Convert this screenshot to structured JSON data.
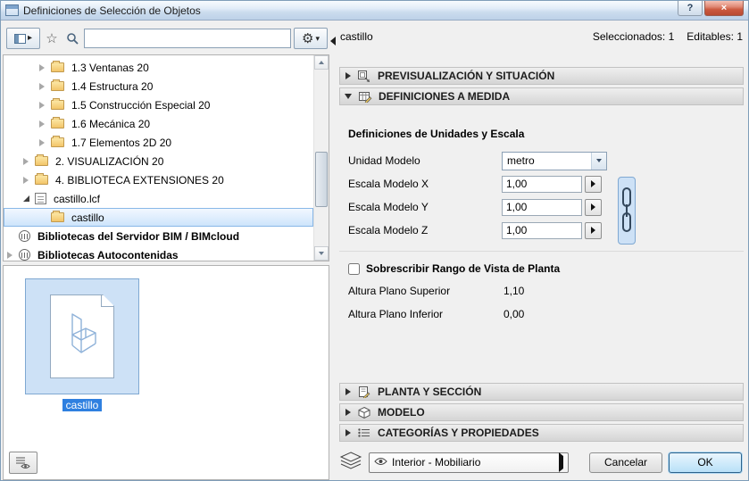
{
  "window": {
    "title": "Definiciones de Selección de Objetos",
    "help_label": "?",
    "close_label": "×"
  },
  "icons": {
    "star": "☆",
    "gear": "⚙",
    "caret_right": "▸",
    "caret_down": "▾"
  },
  "left": {
    "search_value": "",
    "tree": [
      {
        "label": "1.3 Ventanas 20"
      },
      {
        "label": "1.4 Estructura 20"
      },
      {
        "label": "1.5 Construcción Especial 20"
      },
      {
        "label": "1.6 Mecánica 20"
      },
      {
        "label": "1.7 Elementos 2D 20"
      },
      {
        "label": "2. VISUALIZACIÓN 20"
      },
      {
        "label": "4. BIBLIOTECA EXTENSIONES 20"
      },
      {
        "label": "castillo.lcf"
      },
      {
        "label": "castillo"
      },
      {
        "label": "Bibliotecas del Servidor BIM / BIMcloud"
      },
      {
        "label": "Bibliotecas Autocontenidas"
      }
    ],
    "preview_label": "castillo"
  },
  "right": {
    "title": "castillo",
    "status_selected": "Seleccionados: 1",
    "status_editable": "Editables: 1",
    "sections": {
      "preview": "PREVISUALIZACIÓN Y SITUACIÓN",
      "custom": "DEFINICIONES A MEDIDA",
      "plan": "PLANTA Y SECCIÓN",
      "model": "MODELO",
      "categories": "CATEGORÍAS Y PROPIEDADES"
    },
    "custom": {
      "group_title": "Definiciones de Unidades y Escala",
      "unit_label": "Unidad Modelo",
      "unit_value": "metro",
      "scale_x_label": "Escala Modelo X",
      "scale_x_value": "1,00",
      "scale_y_label": "Escala Modelo Y",
      "scale_y_value": "1,00",
      "scale_z_label": "Escala Modelo Z",
      "scale_z_value": "1,00",
      "override_label": "Sobrescribir Rango de Vista de Planta",
      "upper_label": "Altura Plano Superior",
      "upper_value": "1,10",
      "lower_label": "Altura Plano Inferior",
      "lower_value": "0,00"
    },
    "footer": {
      "layer_value": "Interior - Mobiliario",
      "cancel_label": "Cancelar",
      "ok_label": "OK"
    }
  },
  "colors": {
    "selection_blue": "#2f80e0",
    "thumbnail_highlight": "#cde1f6",
    "titlebar_blue": "#bdd1e8"
  }
}
